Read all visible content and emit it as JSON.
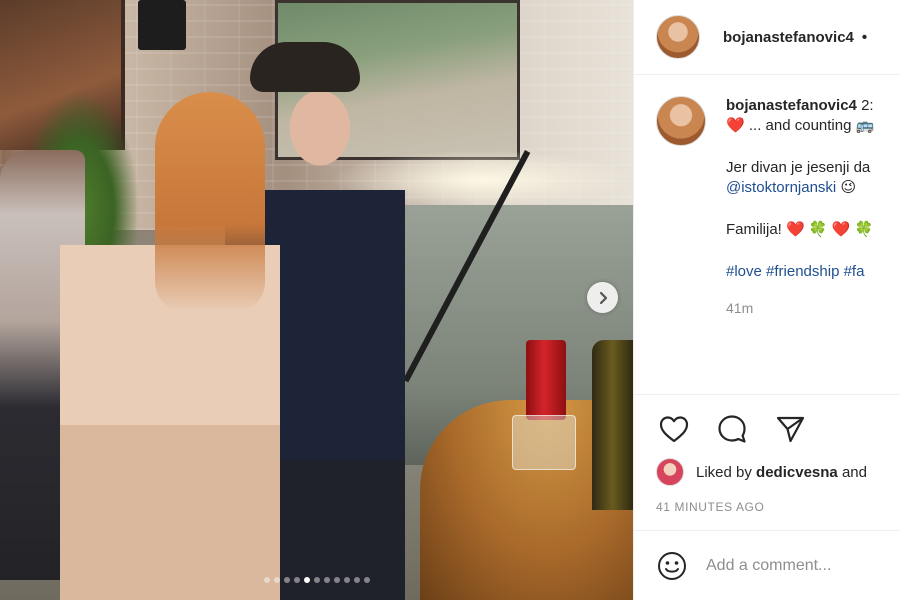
{
  "post": {
    "username": "bojanastefanovic4",
    "header_separator": "•",
    "caption": {
      "user": "bojanastefanovic4",
      "timestamp_prefix": "2:",
      "line1_heart": "❤️",
      "line1_text": "... and counting",
      "line1_emoji": "🚌",
      "line2_text": "Jer divan je jesenji da",
      "line3_mention": "@istoktornjanski",
      "line3_emoji": "😉",
      "line4_text": "Familija!",
      "line4_emojis": [
        "❤️",
        "🍀",
        "❤️",
        "🍀"
      ],
      "hashtags": "#love #friendship #fa"
    },
    "relative_time": "41m",
    "likes": {
      "prefix": "Liked by",
      "user": "dedicvesna",
      "suffix": "and"
    },
    "absolute_time": "41 MINUTES AGO",
    "comment_placeholder": "Add a comment..."
  },
  "carousel": {
    "total_slides": 11,
    "active_slide": 4
  },
  "icons": {
    "next": "chevron-right-icon",
    "like": "heart-outline-icon",
    "comment": "comment-bubble-icon",
    "share": "paper-plane-icon",
    "emoji": "smiley-face-icon"
  },
  "colors": {
    "text": "#262626",
    "muted": "#8e8e8e",
    "link": "#1f4f8f",
    "border": "#efefef"
  }
}
